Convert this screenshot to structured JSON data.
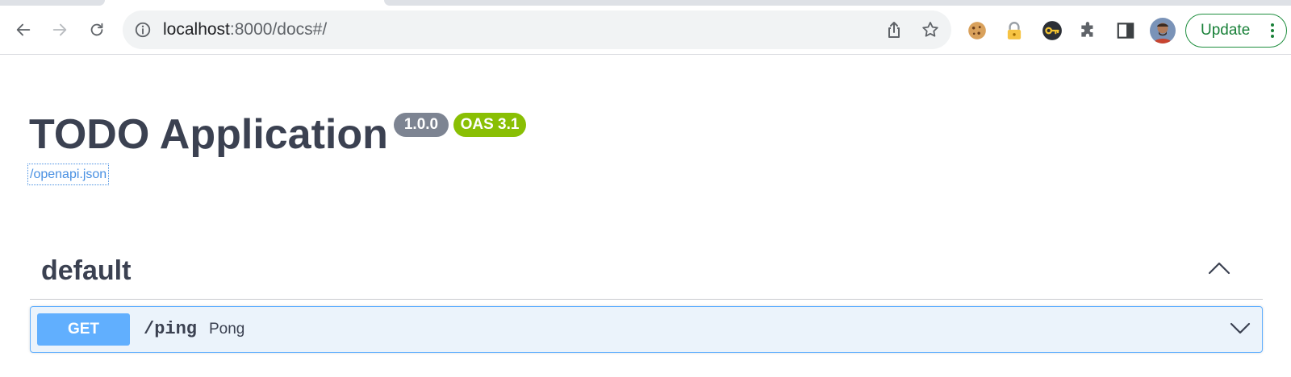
{
  "browser": {
    "url_host": "localhost",
    "url_rest": ":8000/docs#/",
    "update_label": "Update",
    "icons": {
      "back": "arrow-left-icon",
      "forward": "arrow-right-icon",
      "reload": "reload-icon",
      "info": "info-icon",
      "share": "share-icon",
      "bookmark": "star-icon",
      "extensions": [
        "cookie-icon",
        "lock-icon",
        "key-icon",
        "puzzle-icon",
        "side-panel-icon"
      ],
      "menu": "kebab-menu-icon"
    },
    "colors": {
      "update_accent": "#1e8e3e",
      "omnibox_bg": "#f1f3f4"
    }
  },
  "swagger": {
    "title": "TODO Application",
    "version": "1.0.0",
    "oas_version": "OAS 3.1",
    "spec_link": "/openapi.json",
    "tags": [
      {
        "name": "default",
        "expanded": true,
        "operations": [
          {
            "method": "GET",
            "path": "/ping",
            "summary": "Pong"
          }
        ]
      }
    ],
    "colors": {
      "text": "#3b4151",
      "version_badge": "#7d8492",
      "oas_badge": "#89bf04",
      "get_method": "#61affe",
      "get_bg": "#ebf3fb",
      "link": "#4990e2"
    }
  }
}
